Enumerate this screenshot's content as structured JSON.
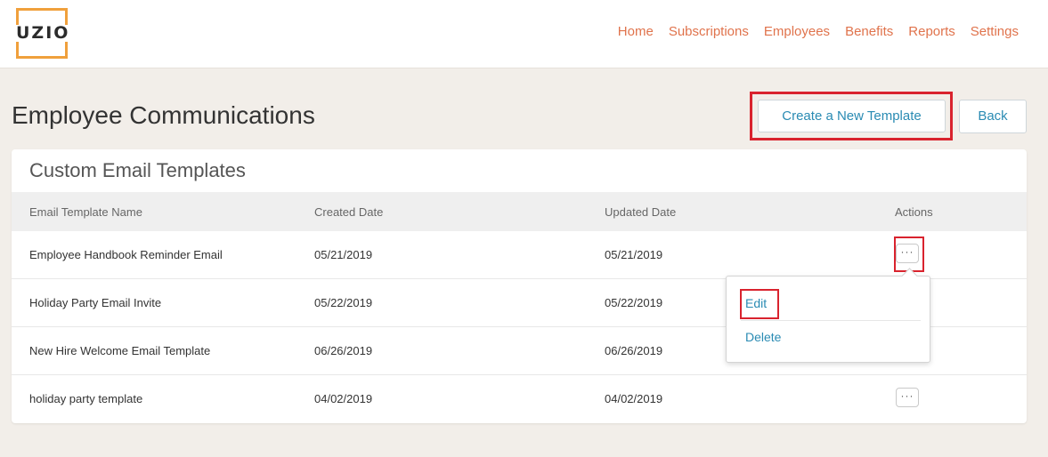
{
  "header": {
    "logo_text": "UZIO",
    "nav": [
      "Home",
      "Subscriptions",
      "Employees",
      "Benefits",
      "Reports",
      "Settings"
    ]
  },
  "page": {
    "title": "Employee Communications",
    "create_button": "Create a New Template",
    "back_button": "Back"
  },
  "card": {
    "title": "Custom Email Templates",
    "columns": [
      "Email Template Name",
      "Created Date",
      "Updated Date",
      "Actions"
    ],
    "rows": [
      {
        "name": "Employee Handbook Reminder Email",
        "created": "05/21/2019",
        "updated": "05/21/2019",
        "actions": "···"
      },
      {
        "name": "Holiday Party Email Invite",
        "created": "05/22/2019",
        "updated": "05/22/2019",
        "actions": ""
      },
      {
        "name": "New Hire Welcome Email Template",
        "created": "06/26/2019",
        "updated": "06/26/2019",
        "actions": ""
      },
      {
        "name": "holiday party template",
        "created": "04/02/2019",
        "updated": "04/02/2019",
        "actions": "···"
      }
    ]
  },
  "dropdown": {
    "edit": "Edit",
    "delete": "Delete"
  },
  "colors": {
    "accent": "#2a8bb3",
    "nav": "#e0734c",
    "logo": "#f0a03c",
    "highlight": "#d9232e",
    "background": "#f2eee9"
  }
}
